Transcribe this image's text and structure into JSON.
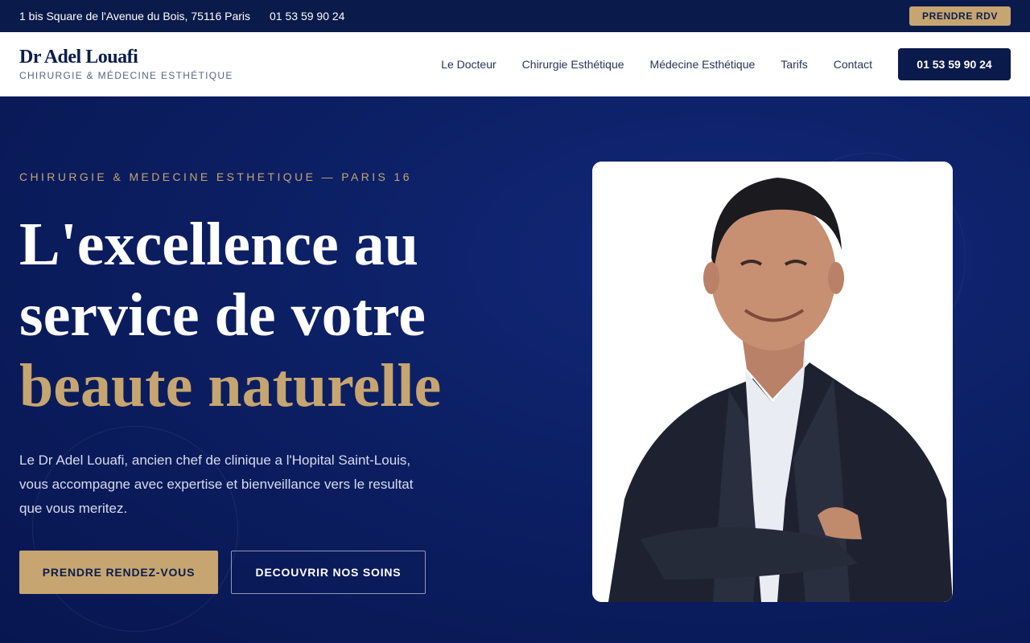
{
  "topbar": {
    "address": "1 bis Square de l'Avenue du Bois, 75116 Paris",
    "phone": "01 53 59 90 24",
    "rdv_label": "PRENDRE RDV"
  },
  "header": {
    "brand_name": "Dr Adel Louafi",
    "brand_tagline": "CHIRURGIE & MÉDECINE ESTHÉTIQUE",
    "nav": [
      {
        "label": "Le Docteur"
      },
      {
        "label": "Chirurgie Esthétique"
      },
      {
        "label": "Médecine Esthétique"
      },
      {
        "label": "Tarifs"
      },
      {
        "label": "Contact"
      }
    ],
    "phone_button": "01 53 59 90 24"
  },
  "hero": {
    "eyebrow": "CHIRURGIE & MEDECINE ESTHETIQUE — PARIS 16",
    "headline_line1": "L'excellence au",
    "headline_line2": "service de votre",
    "headline_accent": "beaute naturelle",
    "intro": "Le Dr Adel Louafi, ancien chef de clinique a l'Hopital Saint-Louis, vous accompagne avec expertise et bienveillance vers le resultat que vous meritez.",
    "primary_cta": "PRENDRE RENDEZ-VOUS",
    "secondary_cta": "DECOUVRIR NOS SOINS"
  },
  "colors": {
    "navy": "#0a1a4a",
    "hero_blue": "#0c1f63",
    "gold": "#c6a570",
    "white": "#ffffff"
  }
}
